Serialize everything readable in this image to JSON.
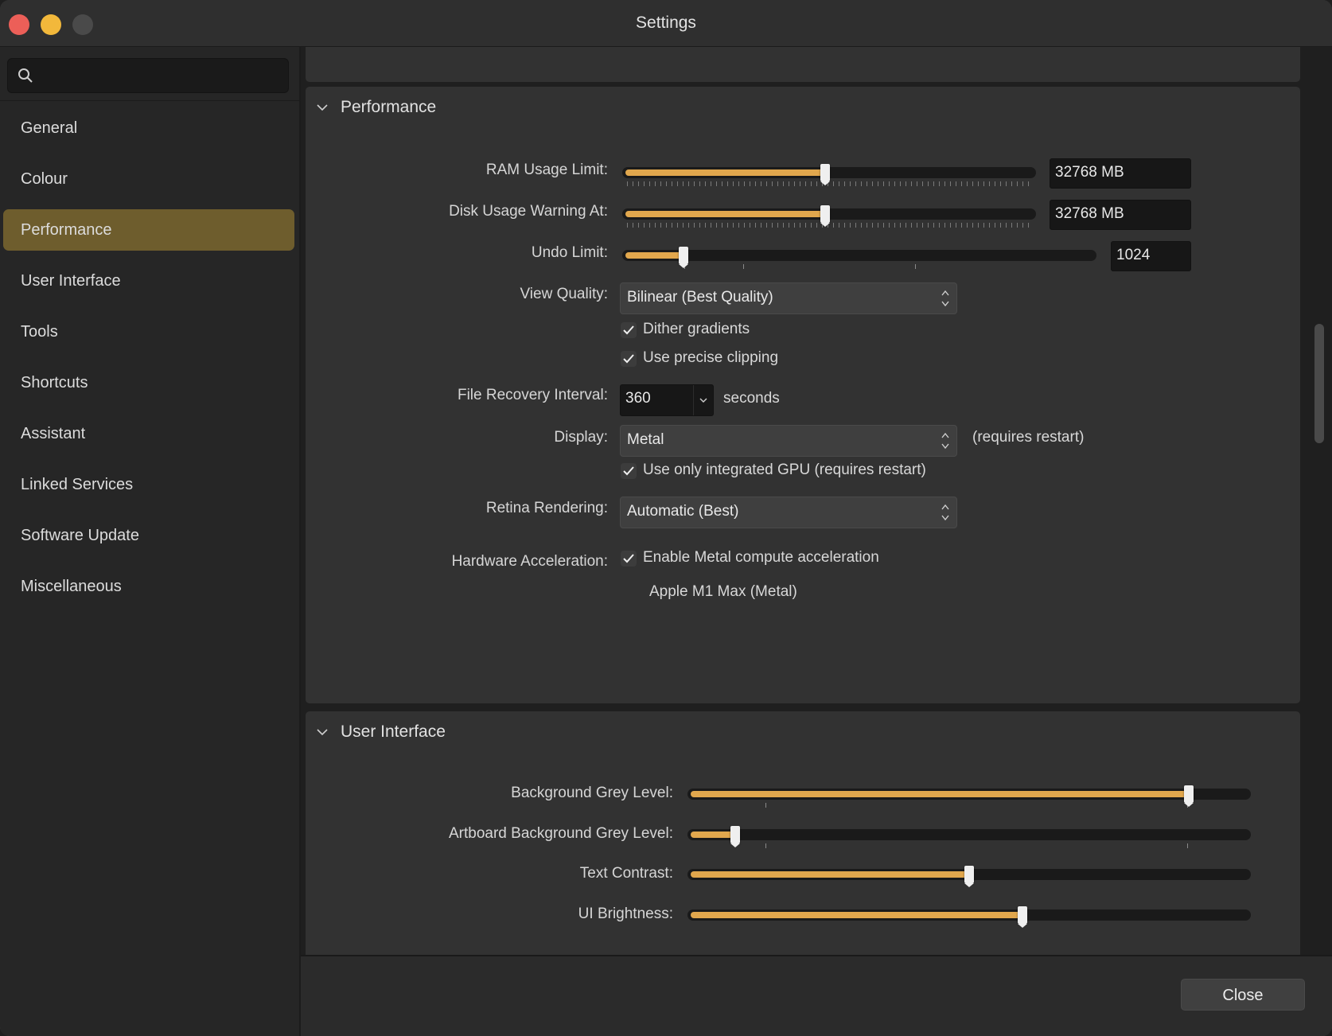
{
  "window": {
    "title": "Settings"
  },
  "search": {
    "placeholder": "",
    "value": ""
  },
  "sidebar": {
    "items": [
      {
        "label": "General"
      },
      {
        "label": "Colour"
      },
      {
        "label": "Performance"
      },
      {
        "label": "User Interface"
      },
      {
        "label": "Tools"
      },
      {
        "label": "Shortcuts"
      },
      {
        "label": "Assistant"
      },
      {
        "label": "Linked Services"
      },
      {
        "label": "Software Update"
      },
      {
        "label": "Miscellaneous"
      }
    ],
    "active": "Performance"
  },
  "performance": {
    "title": "Performance",
    "ram": {
      "label": "RAM Usage Limit:",
      "value": "32768 MB",
      "level": 0.49
    },
    "disk": {
      "label": "Disk Usage Warning At:",
      "value": "32768 MB",
      "level": 0.49
    },
    "undo": {
      "label": "Undo Limit:",
      "value": "1024",
      "level": 0.13
    },
    "view_quality": {
      "label": "View Quality:",
      "value": "Bilinear (Best Quality)"
    },
    "dither": {
      "label": "Dither gradients",
      "checked": true
    },
    "precise": {
      "label": "Use precise clipping",
      "checked": true
    },
    "recovery": {
      "label": "File Recovery Interval:",
      "value": "360",
      "unit": "seconds"
    },
    "display": {
      "label": "Display:",
      "value": "Metal",
      "note": "(requires restart)"
    },
    "gpu": {
      "label": "Use only integrated GPU (requires restart)",
      "checked": true
    },
    "retina": {
      "label": "Retina Rendering:",
      "value": "Automatic (Best)"
    },
    "hw": {
      "label": "Hardware Acceleration:",
      "option": "Enable Metal compute acceleration",
      "checked": true,
      "device": "Apple M1 Max (Metal)"
    }
  },
  "user_interface": {
    "title": "User Interface",
    "bg_grey": {
      "label": "Background Grey Level:",
      "level": 0.89
    },
    "artboard_grey": {
      "label": "Artboard Background Grey Level:",
      "level": 0.085
    },
    "text_contrast": {
      "label": "Text Contrast:",
      "level": 0.5
    },
    "ui_brightness": {
      "label": "UI Brightness:",
      "level": 0.595
    }
  },
  "footer": {
    "close_label": "Close"
  },
  "colors": {
    "accent": "#e1a74d",
    "active_nav": "#6e5d2d"
  }
}
